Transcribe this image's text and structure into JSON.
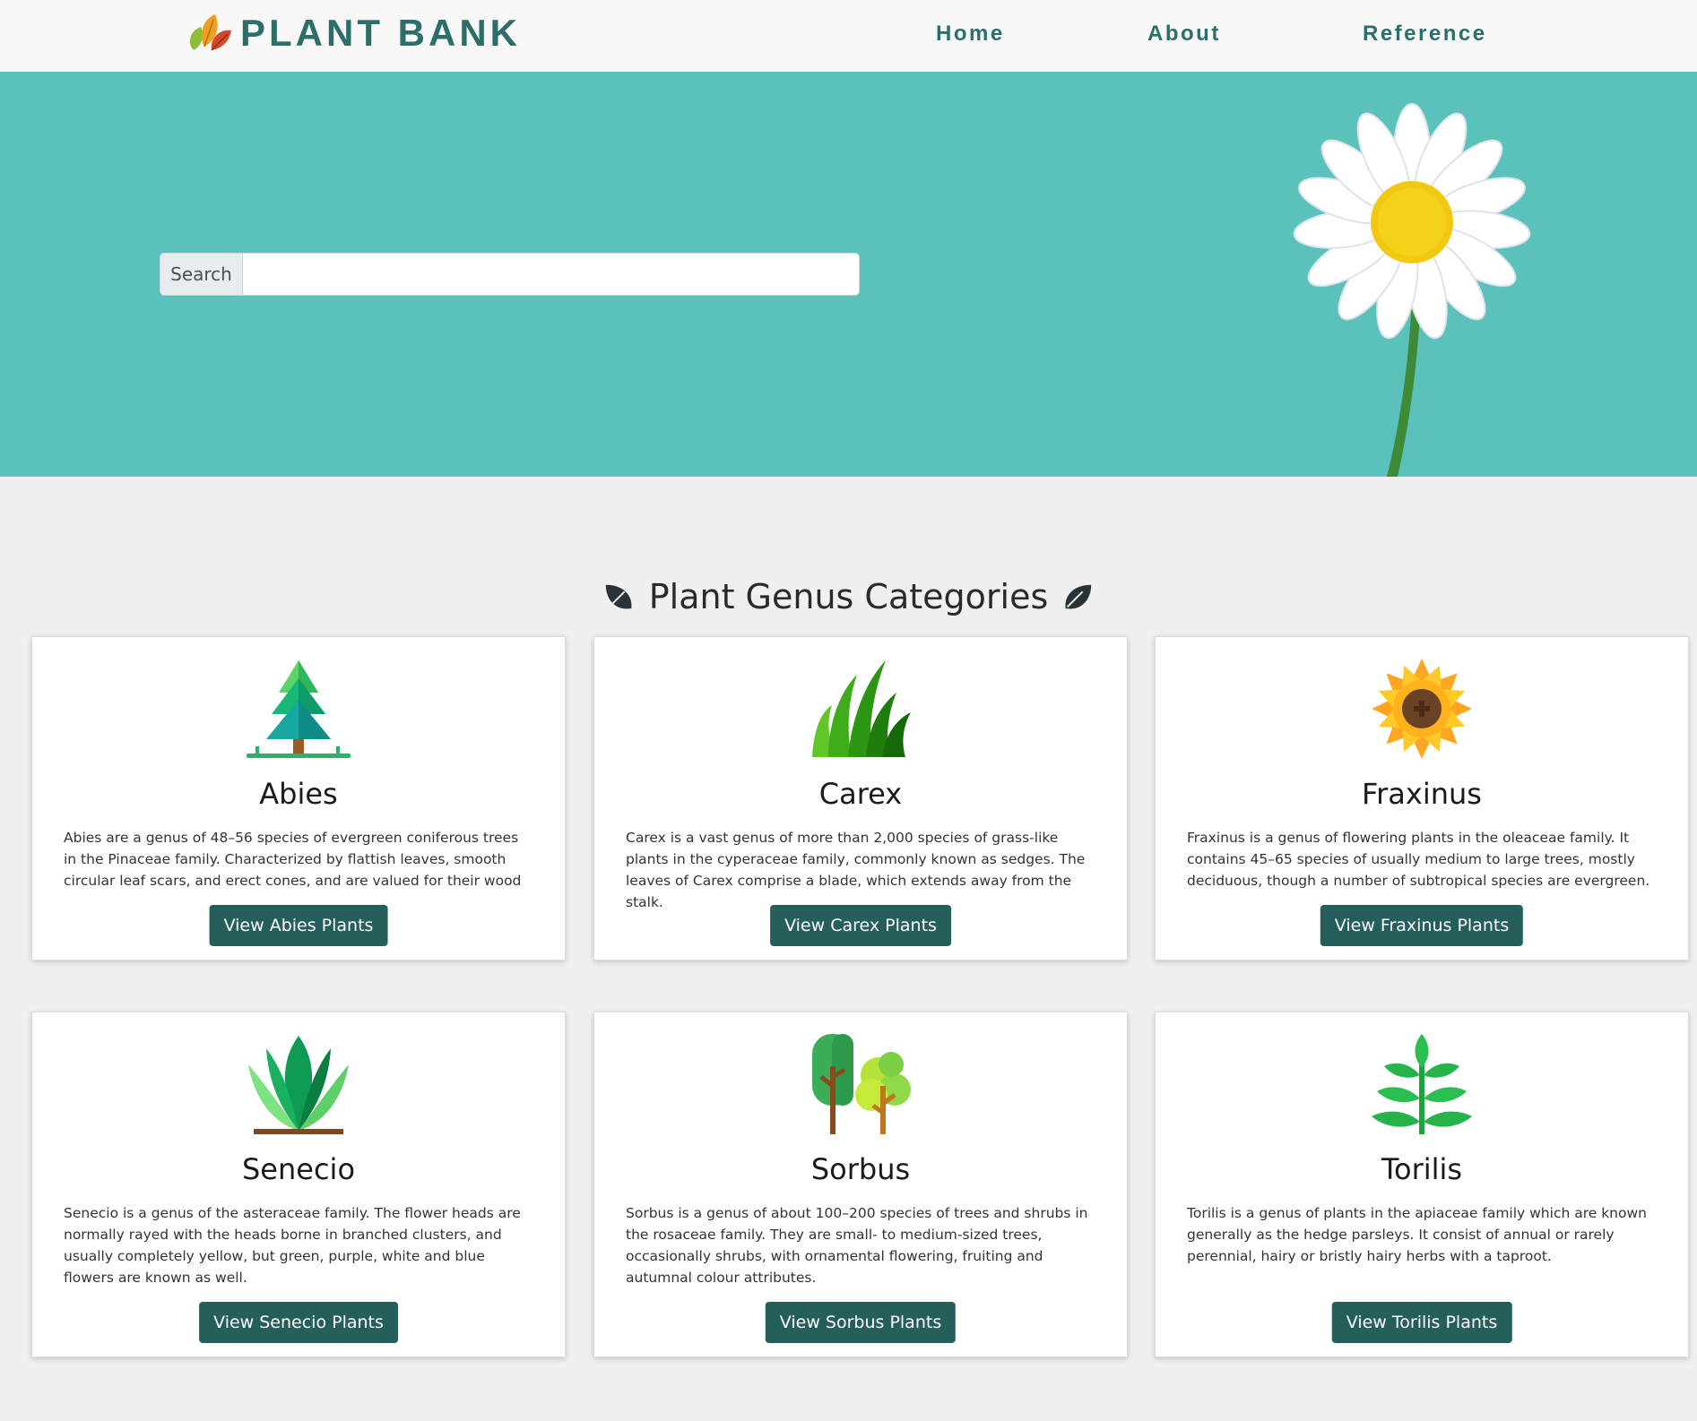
{
  "brand": {
    "name": "PLANT BANK",
    "logo_icon": "autumn-leaves-icon"
  },
  "nav": {
    "home": "Home",
    "about": "About",
    "reference": "Reference"
  },
  "hero": {
    "search_label": "Search",
    "search_value": "",
    "search_placeholder": "",
    "image_icon": "daisy-flower-icon"
  },
  "section": {
    "title": "Plant Genus Categories",
    "icon": "leaf-icon"
  },
  "colors": {
    "accent": "#2c6e6a",
    "hero_bg": "#5bc1bb",
    "button_bg": "#255f5b",
    "page_bg": "#f0f0f0"
  },
  "cards": [
    {
      "title": "Abies",
      "icon": "fir-tree-icon",
      "text": "Abies are a genus of 48–56 species of evergreen coniferous trees in the Pinaceae family. Characterized by flattish leaves, smooth circular leaf scars, and erect cones, and are valued for their wood",
      "button": "View Abies Plants"
    },
    {
      "title": "Carex",
      "icon": "grass-icon",
      "text": "Carex is a vast genus of more than 2,000 species of grass-like plants in the cyperaceae family, commonly known as sedges. The leaves of Carex comprise a blade, which extends away from the stalk.",
      "button": "View Carex Plants"
    },
    {
      "title": "Fraxinus",
      "icon": "sunflower-icon",
      "text": "Fraxinus is a genus of flowering plants in the oleaceae family. It contains 45–65 species of usually medium to large trees, mostly deciduous, though a number of subtropical species are evergreen.",
      "button": "View Fraxinus Plants"
    },
    {
      "title": "Senecio",
      "icon": "succulent-plant-icon",
      "text": "Senecio is a genus of the asteraceae family. The flower heads are normally rayed with the heads borne in branched clusters, and usually completely yellow, but green, purple, white and blue flowers are known as well.",
      "button": "View Senecio Plants"
    },
    {
      "title": "Sorbus",
      "icon": "trees-icon",
      "text": "Sorbus is a genus of about 100–200 species of trees and shrubs in the rosaceae family. They are small- to medium-sized trees, occasionally shrubs, with ornamental flowering, fruiting and autumnal colour attributes.",
      "button": "View Sorbus Plants"
    },
    {
      "title": "Torilis",
      "icon": "fern-leaf-icon",
      "text": "Torilis is a genus of plants in the apiaceae family which are known generally as the hedge parsleys. It consist of annual or rarely perennial, hairy or bristly hairy herbs with a taproot.",
      "button": "View Torilis Plants"
    }
  ]
}
